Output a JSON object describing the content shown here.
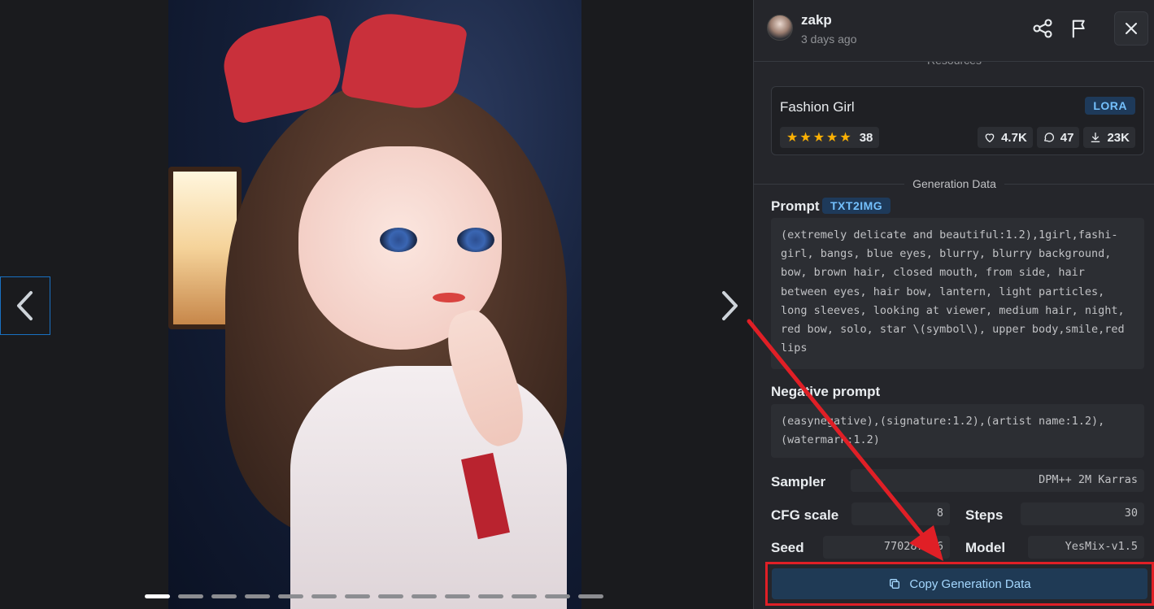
{
  "viewer": {
    "dots_count": 14,
    "active_dot": 0
  },
  "header": {
    "username": "zakp",
    "time": "3 days ago"
  },
  "resources": {
    "label": "Resources",
    "name": "Fashion Girl",
    "type": "LORA",
    "rating_count": "38",
    "likes": "4.7K",
    "comments": "47",
    "downloads": "23K"
  },
  "generation": {
    "section_label": "Generation Data",
    "prompt_label": "Prompt",
    "prompt_type": "TXT2IMG",
    "prompt": "(extremely delicate and beautiful:1.2),1girl,fashi-girl, bangs, blue eyes, blurry, blurry background, bow, brown hair, closed mouth, from side, hair between eyes, hair bow, lantern, light particles, long sleeves, looking at viewer, medium hair, night, red bow, solo, star \\(symbol\\), upper body,smile,red lips",
    "negative_label": "Negative prompt",
    "negative_prompt": "(easynegative),(signature:1.2),(artist name:1.2),(watermark:1.2)",
    "sampler_label": "Sampler",
    "sampler": "DPM++ 2M Karras",
    "cfg_label": "CFG scale",
    "cfg": "8",
    "steps_label": "Steps",
    "steps": "30",
    "seed_label": "Seed",
    "seed": "770287296",
    "model_label": "Model",
    "model": "YesMix-v1.5"
  },
  "copy_button": {
    "label": "Copy Generation Data"
  },
  "colors": {
    "accent": "#1971c2",
    "badge_text": "#74c0fc",
    "star": "#fab005",
    "annotation_red": "#e01f26"
  }
}
